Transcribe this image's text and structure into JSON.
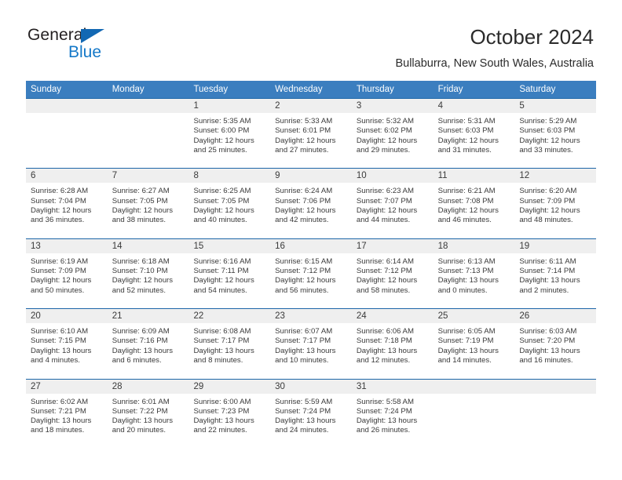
{
  "logo": {
    "line1": "General",
    "line2": "Blue",
    "triangle_color": "#1268b3",
    "blue_text_color": "#1478c8"
  },
  "header": {
    "title": "October 2024",
    "subtitle": "Bullaburra, New South Wales, Australia"
  },
  "theme": {
    "header_bar_color": "#3b7ebf",
    "cell_top_border_color": "#1d66a8",
    "daynum_bg_color": "#efefef",
    "text_color": "#3a3a3a"
  },
  "calendar": {
    "day_names": [
      "Sunday",
      "Monday",
      "Tuesday",
      "Wednesday",
      "Thursday",
      "Friday",
      "Saturday"
    ],
    "weeks": [
      [
        {
          "day": "",
          "sunrise": "",
          "sunset": "",
          "daylight1": "",
          "daylight2": "",
          "empty": true
        },
        {
          "day": "",
          "sunrise": "",
          "sunset": "",
          "daylight1": "",
          "daylight2": "",
          "empty": true
        },
        {
          "day": "1",
          "sunrise": "Sunrise: 5:35 AM",
          "sunset": "Sunset: 6:00 PM",
          "daylight1": "Daylight: 12 hours",
          "daylight2": "and 25 minutes."
        },
        {
          "day": "2",
          "sunrise": "Sunrise: 5:33 AM",
          "sunset": "Sunset: 6:01 PM",
          "daylight1": "Daylight: 12 hours",
          "daylight2": "and 27 minutes."
        },
        {
          "day": "3",
          "sunrise": "Sunrise: 5:32 AM",
          "sunset": "Sunset: 6:02 PM",
          "daylight1": "Daylight: 12 hours",
          "daylight2": "and 29 minutes."
        },
        {
          "day": "4",
          "sunrise": "Sunrise: 5:31 AM",
          "sunset": "Sunset: 6:03 PM",
          "daylight1": "Daylight: 12 hours",
          "daylight2": "and 31 minutes."
        },
        {
          "day": "5",
          "sunrise": "Sunrise: 5:29 AM",
          "sunset": "Sunset: 6:03 PM",
          "daylight1": "Daylight: 12 hours",
          "daylight2": "and 33 minutes."
        }
      ],
      [
        {
          "day": "6",
          "sunrise": "Sunrise: 6:28 AM",
          "sunset": "Sunset: 7:04 PM",
          "daylight1": "Daylight: 12 hours",
          "daylight2": "and 36 minutes."
        },
        {
          "day": "7",
          "sunrise": "Sunrise: 6:27 AM",
          "sunset": "Sunset: 7:05 PM",
          "daylight1": "Daylight: 12 hours",
          "daylight2": "and 38 minutes."
        },
        {
          "day": "8",
          "sunrise": "Sunrise: 6:25 AM",
          "sunset": "Sunset: 7:05 PM",
          "daylight1": "Daylight: 12 hours",
          "daylight2": "and 40 minutes."
        },
        {
          "day": "9",
          "sunrise": "Sunrise: 6:24 AM",
          "sunset": "Sunset: 7:06 PM",
          "daylight1": "Daylight: 12 hours",
          "daylight2": "and 42 minutes."
        },
        {
          "day": "10",
          "sunrise": "Sunrise: 6:23 AM",
          "sunset": "Sunset: 7:07 PM",
          "daylight1": "Daylight: 12 hours",
          "daylight2": "and 44 minutes."
        },
        {
          "day": "11",
          "sunrise": "Sunrise: 6:21 AM",
          "sunset": "Sunset: 7:08 PM",
          "daylight1": "Daylight: 12 hours",
          "daylight2": "and 46 minutes."
        },
        {
          "day": "12",
          "sunrise": "Sunrise: 6:20 AM",
          "sunset": "Sunset: 7:09 PM",
          "daylight1": "Daylight: 12 hours",
          "daylight2": "and 48 minutes."
        }
      ],
      [
        {
          "day": "13",
          "sunrise": "Sunrise: 6:19 AM",
          "sunset": "Sunset: 7:09 PM",
          "daylight1": "Daylight: 12 hours",
          "daylight2": "and 50 minutes."
        },
        {
          "day": "14",
          "sunrise": "Sunrise: 6:18 AM",
          "sunset": "Sunset: 7:10 PM",
          "daylight1": "Daylight: 12 hours",
          "daylight2": "and 52 minutes."
        },
        {
          "day": "15",
          "sunrise": "Sunrise: 6:16 AM",
          "sunset": "Sunset: 7:11 PM",
          "daylight1": "Daylight: 12 hours",
          "daylight2": "and 54 minutes."
        },
        {
          "day": "16",
          "sunrise": "Sunrise: 6:15 AM",
          "sunset": "Sunset: 7:12 PM",
          "daylight1": "Daylight: 12 hours",
          "daylight2": "and 56 minutes."
        },
        {
          "day": "17",
          "sunrise": "Sunrise: 6:14 AM",
          "sunset": "Sunset: 7:12 PM",
          "daylight1": "Daylight: 12 hours",
          "daylight2": "and 58 minutes."
        },
        {
          "day": "18",
          "sunrise": "Sunrise: 6:13 AM",
          "sunset": "Sunset: 7:13 PM",
          "daylight1": "Daylight: 13 hours",
          "daylight2": "and 0 minutes."
        },
        {
          "day": "19",
          "sunrise": "Sunrise: 6:11 AM",
          "sunset": "Sunset: 7:14 PM",
          "daylight1": "Daylight: 13 hours",
          "daylight2": "and 2 minutes."
        }
      ],
      [
        {
          "day": "20",
          "sunrise": "Sunrise: 6:10 AM",
          "sunset": "Sunset: 7:15 PM",
          "daylight1": "Daylight: 13 hours",
          "daylight2": "and 4 minutes."
        },
        {
          "day": "21",
          "sunrise": "Sunrise: 6:09 AM",
          "sunset": "Sunset: 7:16 PM",
          "daylight1": "Daylight: 13 hours",
          "daylight2": "and 6 minutes."
        },
        {
          "day": "22",
          "sunrise": "Sunrise: 6:08 AM",
          "sunset": "Sunset: 7:17 PM",
          "daylight1": "Daylight: 13 hours",
          "daylight2": "and 8 minutes."
        },
        {
          "day": "23",
          "sunrise": "Sunrise: 6:07 AM",
          "sunset": "Sunset: 7:17 PM",
          "daylight1": "Daylight: 13 hours",
          "daylight2": "and 10 minutes."
        },
        {
          "day": "24",
          "sunrise": "Sunrise: 6:06 AM",
          "sunset": "Sunset: 7:18 PM",
          "daylight1": "Daylight: 13 hours",
          "daylight2": "and 12 minutes."
        },
        {
          "day": "25",
          "sunrise": "Sunrise: 6:05 AM",
          "sunset": "Sunset: 7:19 PM",
          "daylight1": "Daylight: 13 hours",
          "daylight2": "and 14 minutes."
        },
        {
          "day": "26",
          "sunrise": "Sunrise: 6:03 AM",
          "sunset": "Sunset: 7:20 PM",
          "daylight1": "Daylight: 13 hours",
          "daylight2": "and 16 minutes."
        }
      ],
      [
        {
          "day": "27",
          "sunrise": "Sunrise: 6:02 AM",
          "sunset": "Sunset: 7:21 PM",
          "daylight1": "Daylight: 13 hours",
          "daylight2": "and 18 minutes."
        },
        {
          "day": "28",
          "sunrise": "Sunrise: 6:01 AM",
          "sunset": "Sunset: 7:22 PM",
          "daylight1": "Daylight: 13 hours",
          "daylight2": "and 20 minutes."
        },
        {
          "day": "29",
          "sunrise": "Sunrise: 6:00 AM",
          "sunset": "Sunset: 7:23 PM",
          "daylight1": "Daylight: 13 hours",
          "daylight2": "and 22 minutes."
        },
        {
          "day": "30",
          "sunrise": "Sunrise: 5:59 AM",
          "sunset": "Sunset: 7:24 PM",
          "daylight1": "Daylight: 13 hours",
          "daylight2": "and 24 minutes."
        },
        {
          "day": "31",
          "sunrise": "Sunrise: 5:58 AM",
          "sunset": "Sunset: 7:24 PM",
          "daylight1": "Daylight: 13 hours",
          "daylight2": "and 26 minutes."
        },
        {
          "day": "",
          "sunrise": "",
          "sunset": "",
          "daylight1": "",
          "daylight2": "",
          "empty": true
        },
        {
          "day": "",
          "sunrise": "",
          "sunset": "",
          "daylight1": "",
          "daylight2": "",
          "empty": true
        }
      ]
    ]
  }
}
